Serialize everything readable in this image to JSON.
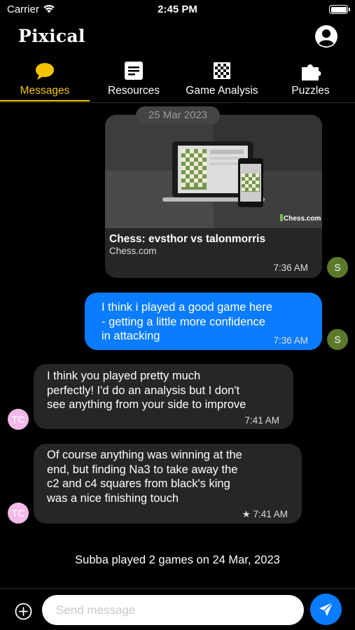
{
  "status_bar": {
    "carrier": "Carrier",
    "time": "2:45 PM"
  },
  "header": {
    "title": "Pixical"
  },
  "tabs": [
    {
      "label": "Messages",
      "icon": "chat-bubble-icon",
      "active": true
    },
    {
      "label": "Resources",
      "icon": "document-icon",
      "active": false
    },
    {
      "label": "Game Analysis",
      "icon": "chessboard-icon",
      "active": false
    },
    {
      "label": "Puzzles",
      "icon": "puzzle-piece-icon",
      "active": false
    }
  ],
  "chat": {
    "date_separator": "25 Mar 2023",
    "link_card": {
      "title": "Chess: evsthor vs talonmorris",
      "source": "Chess.com",
      "preview_brand": "Chess.com",
      "time": "7:36 AM",
      "avatar": "S"
    },
    "messages": [
      {
        "direction": "sent",
        "text": "I think i played a good game here - getting a little more confidence in attacking",
        "time": "7:36 AM",
        "avatar": "S"
      },
      {
        "direction": "received",
        "text": "I think you played pretty much perfectly! I'd do an analysis but I don't see anything from your side to improve",
        "time": "7:41 AM",
        "avatar": "TC"
      },
      {
        "direction": "received",
        "text": "Of course anything was winning at the end, but finding Na3 to take away the c2 and c4 squares from black's king was a nice finishing touch",
        "time": "7:41 AM",
        "starred": true,
        "avatar": "TC"
      }
    ],
    "summary": "Subba played 2 games on 24 Mar, 2023"
  },
  "composer": {
    "placeholder": "Send message"
  },
  "colors": {
    "accent": "#f5c400",
    "sent_bubble": "#0a7cff",
    "received_bubble": "#262626",
    "avatar_s": "#5a7a2a",
    "avatar_tc": "#f2b9ea"
  }
}
